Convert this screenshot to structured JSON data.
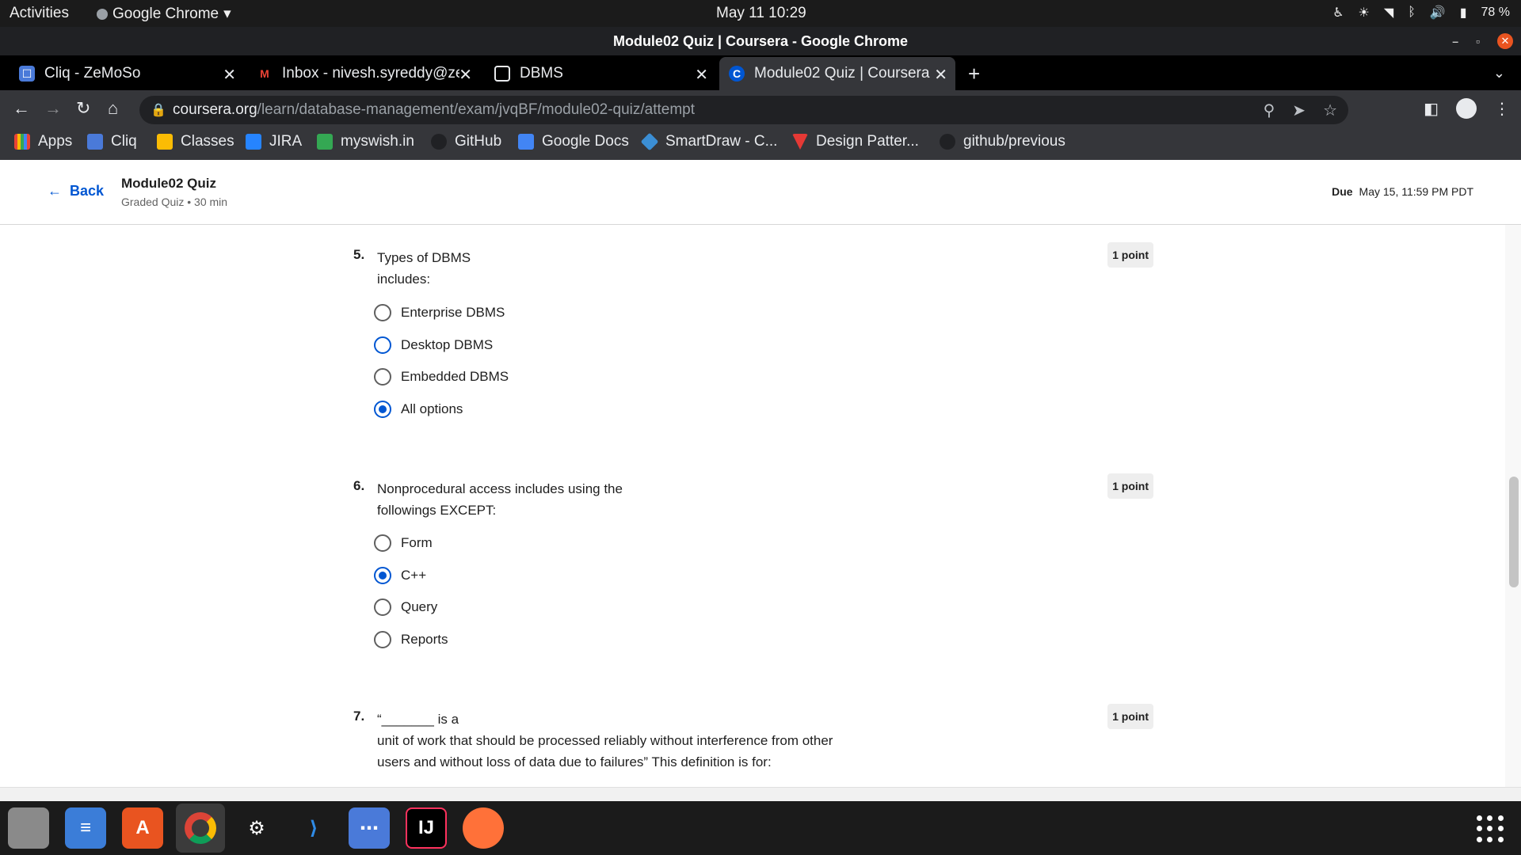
{
  "system_bar": {
    "activities": "Activities",
    "app_name": "Google Chrome",
    "clock": "May 11  10:29",
    "battery": "78 %"
  },
  "window": {
    "title": "Module02 Quiz | Coursera - Google Chrome"
  },
  "tabs": [
    {
      "label": "Cliq - ZeMoSo",
      "icon": "cliq-icon"
    },
    {
      "label": "Inbox - nivesh.syreddy@ze",
      "icon": "gmail-icon"
    },
    {
      "label": "DBMS",
      "icon": "document-icon"
    },
    {
      "label": "Module02 Quiz | Coursera",
      "icon": "coursera-icon",
      "active": true
    }
  ],
  "address_bar": {
    "domain": "coursera.org",
    "path": "/learn/database-management/exam/jvqBF/module02-quiz/attempt"
  },
  "bookmarks": [
    "Apps",
    "Cliq",
    "Classes",
    "JIRA",
    "myswish.in",
    "GitHub",
    "Google Docs",
    "SmartDraw - C...",
    "Design Patter...",
    "github/previous"
  ],
  "page_header": {
    "back": "Back",
    "quiz_title": "Module02 Quiz",
    "quiz_meta": "Graded Quiz • 30 min",
    "due_label": "Due",
    "due_value": "May 15, 11:59 PM PDT"
  },
  "questions": [
    {
      "number": "5.",
      "text": "Types of DBMS\nincludes:",
      "points": "1 point",
      "options": [
        "Enterprise DBMS",
        "Desktop DBMS",
        "Embedded DBMS",
        "All options"
      ],
      "selected": 3
    },
    {
      "number": "6.",
      "text": "Nonprocedural access includes using the\nfollowings EXCEPT:",
      "points": "1 point",
      "options": [
        "Form",
        "C++",
        "Query",
        "Reports"
      ],
      "selected": 1
    },
    {
      "number": "7.",
      "text": "“_______ is a\nunit of work that should be processed reliably without interference from other\nusers and without loss of data due to failures” This definition is for:",
      "points": "1 point",
      "options": [],
      "selected": null
    }
  ],
  "colors": {
    "accent": "#0056d2",
    "chrome_dark": "#35363a",
    "topbar": "#1b1b1b"
  }
}
